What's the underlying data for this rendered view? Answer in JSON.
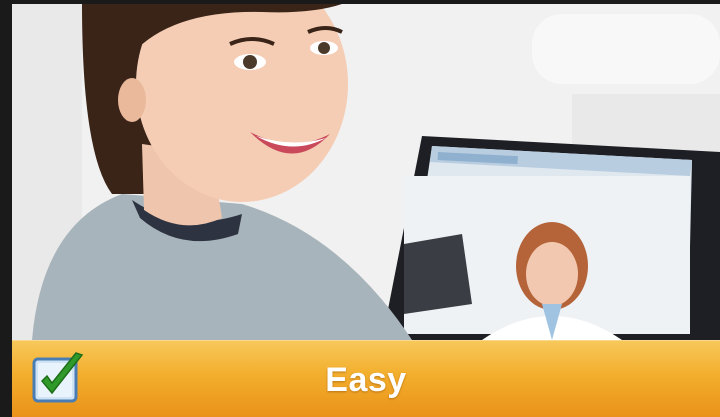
{
  "banner": {
    "label": "Easy",
    "icon": "checkbox-checked-icon",
    "colors": {
      "top": "#f7c85a",
      "bottom": "#e9921a",
      "text": "#ffffff"
    }
  },
  "photo": {
    "subject": "woman-using-laptop-video-call"
  }
}
